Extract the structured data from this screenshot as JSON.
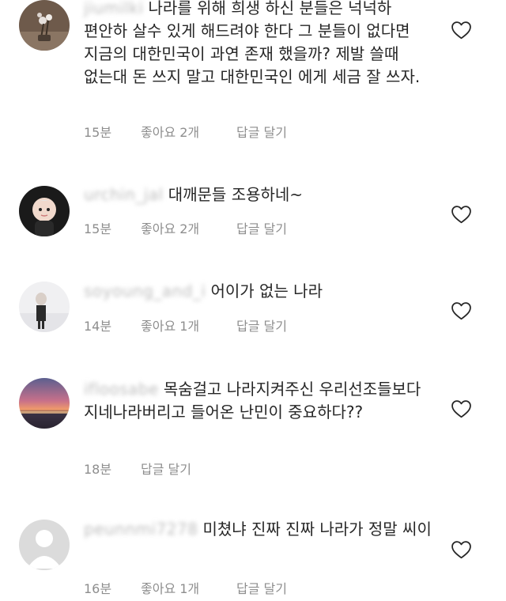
{
  "comments": [
    {
      "username": "jiumilki",
      "text": "나라를 위해 희생 하신 분들은 넉넉하 편안하 살수 있게 해드려야 한다 그 분들이 없다면 지금의 대한민국이 과연 존재 했을까? 제발 쓸때 없는대 돈 쓰지 말고 대한민국인 에게 세금 잘 쓰자.",
      "time": "15분",
      "likes": "좋아요 2개",
      "reply": "답글 달기",
      "avatar": "flowers-photo"
    },
    {
      "username": "urchin_jal",
      "text": "대깨문들 조용하네~",
      "time": "15분",
      "likes": "좋아요 2개",
      "reply": "답글 달기",
      "avatar": "cartoon-character"
    },
    {
      "username": "soyoung_and_i",
      "text": "어이가 없는 나라",
      "time": "14분",
      "likes": "좋아요 1개",
      "reply": "답글 달기",
      "avatar": "person-photo"
    },
    {
      "username": "ifloosabe",
      "text": "목숨걸고 나라지켜주신 우리선조들보다 지네나라버리고 들어온 난민이 중요하다??",
      "time": "18분",
      "likes": "",
      "reply": "답글 달기",
      "avatar": "sunset-photo"
    },
    {
      "username": "peunnmi7278",
      "text": "미쳤냐 진짜 진짜 나라가 정말 씨이",
      "time": "16분",
      "likes": "좋아요 1개",
      "reply": "답글 달기",
      "avatar": "default-avatar"
    }
  ],
  "icons": {
    "like": "heart-outline-icon"
  },
  "colors": {
    "text": "#262626",
    "meta": "#8e8e8e",
    "icon": "#262626"
  }
}
